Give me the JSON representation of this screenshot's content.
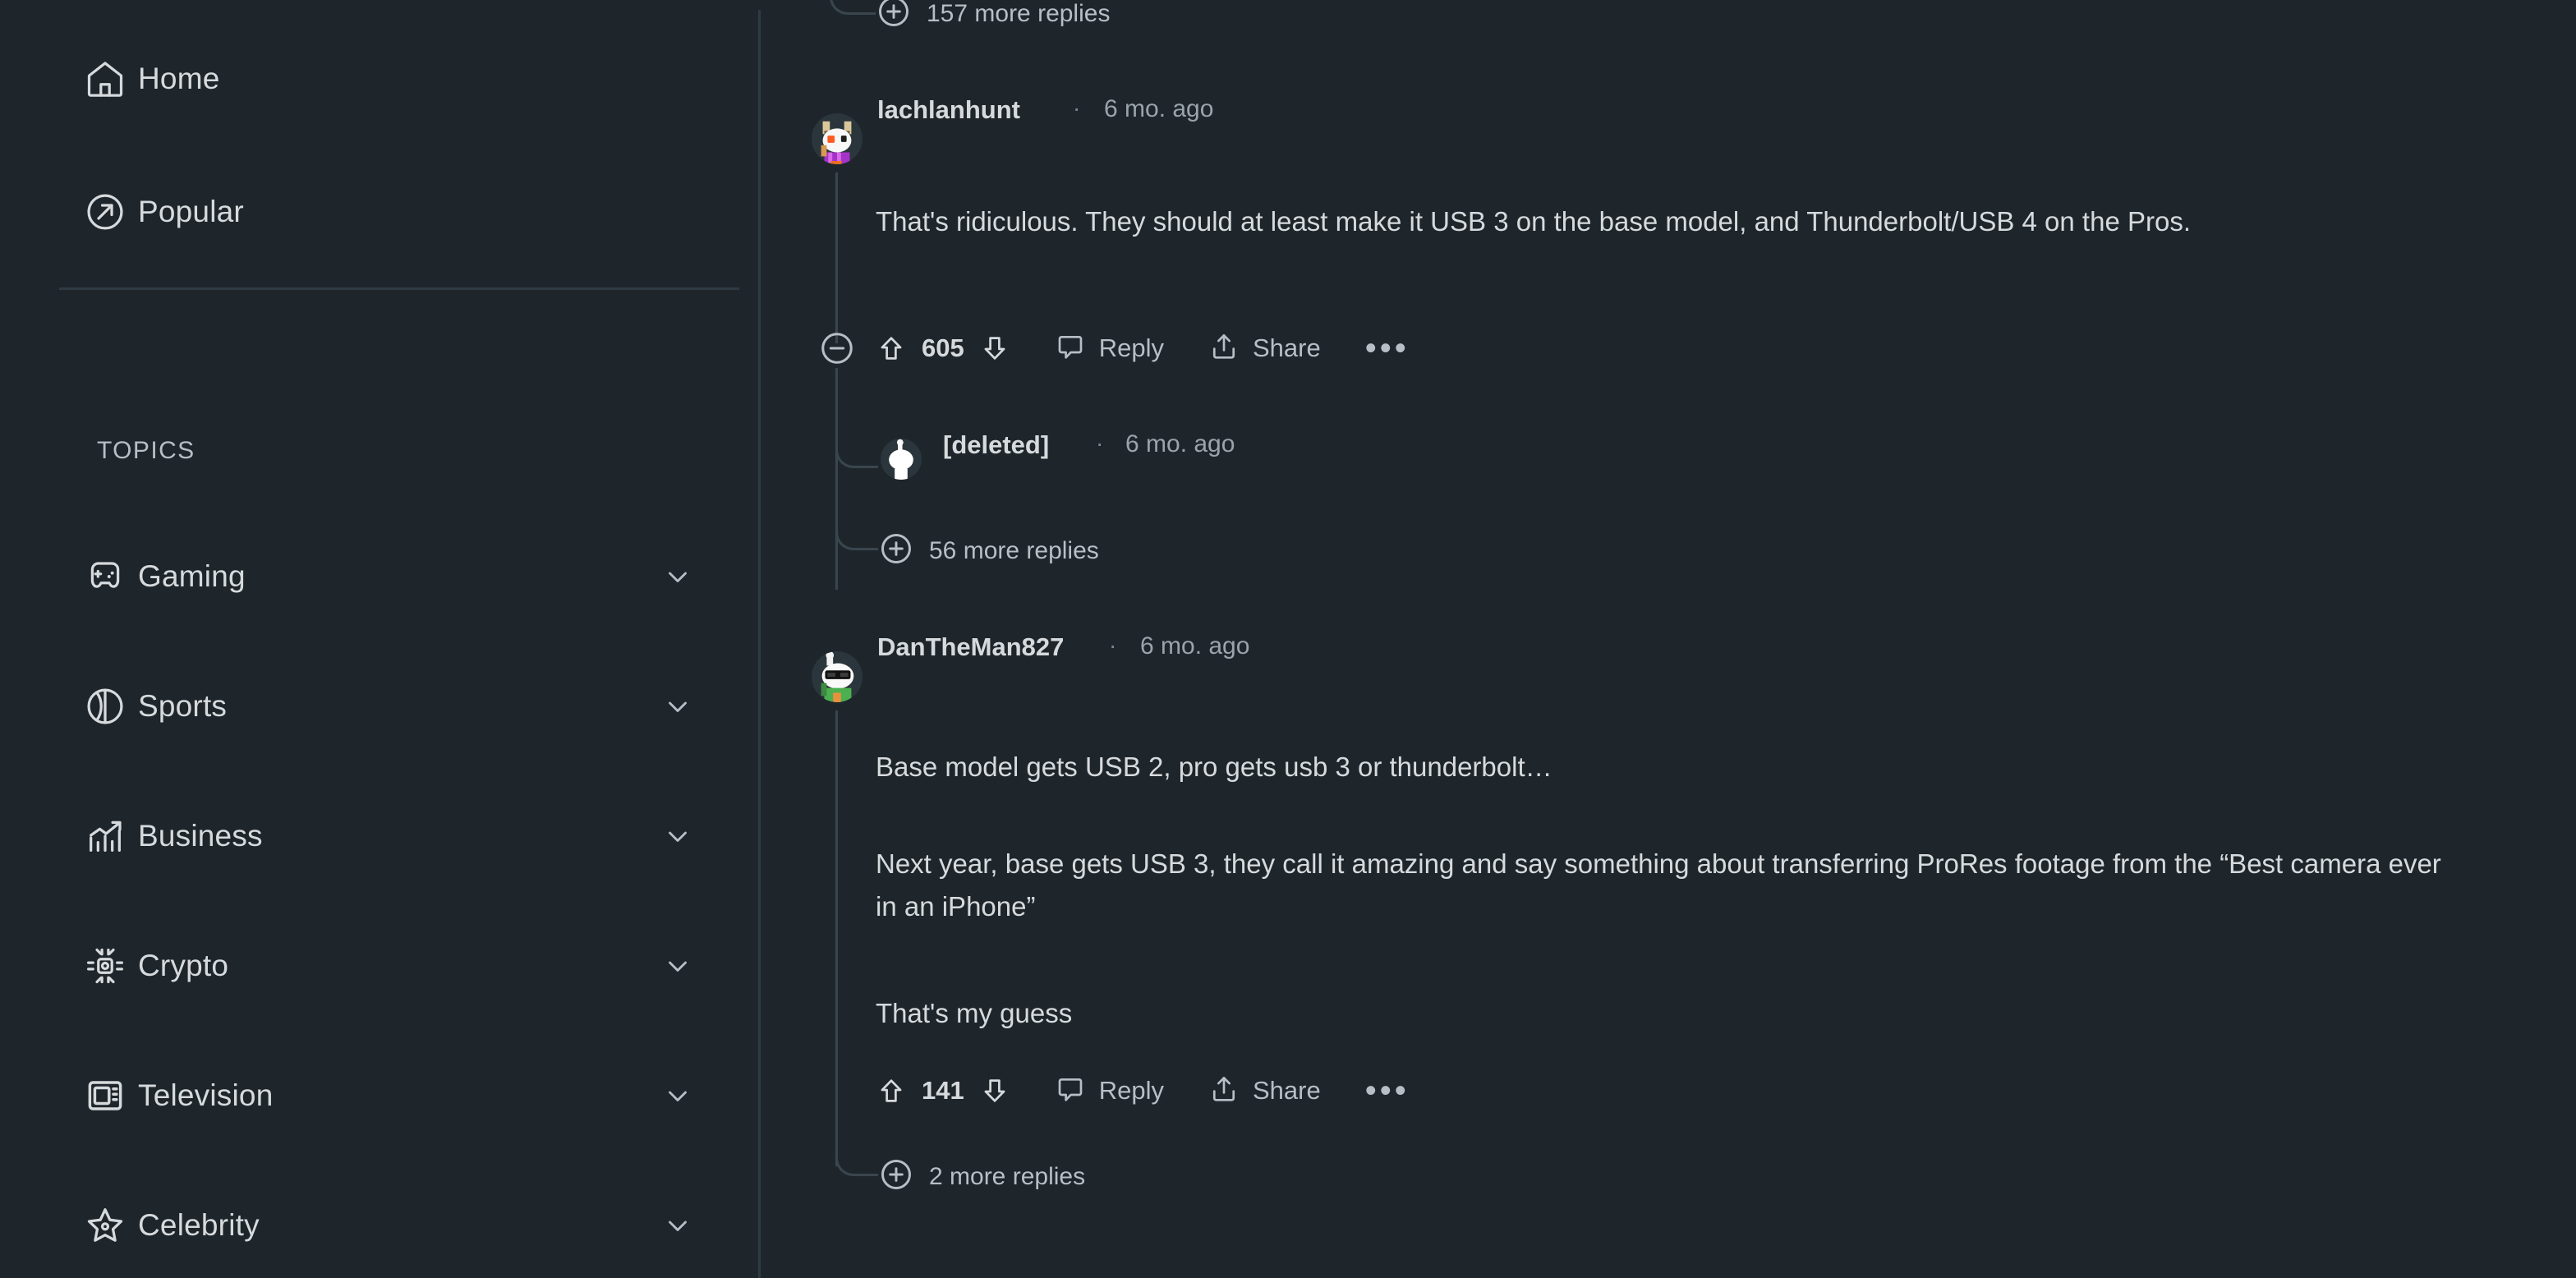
{
  "theme": {
    "background": "#1e262c",
    "divider": "#2f3b43",
    "thread_line": "#3a464e",
    "text_primary": "#d7dadc",
    "text_secondary": "#b6bfc5",
    "text_muted": "#9aa4ab"
  },
  "sidebar": {
    "primary_items": [
      {
        "label": "Home",
        "icon": "home-icon"
      },
      {
        "label": "Popular",
        "icon": "popular-arrow-icon"
      }
    ],
    "topics_header": "TOPICS",
    "topic_items": [
      {
        "label": "Gaming",
        "icon": "gamepad-icon",
        "chevron": "chevron-down-icon"
      },
      {
        "label": "Sports",
        "icon": "sports-ball-icon",
        "chevron": "chevron-down-icon"
      },
      {
        "label": "Business",
        "icon": "chart-bars-icon",
        "chevron": "chevron-down-icon"
      },
      {
        "label": "Crypto",
        "icon": "crypto-icon",
        "chevron": "chevron-down-icon"
      },
      {
        "label": "Television",
        "icon": "television-icon",
        "chevron": "chevron-down-icon"
      },
      {
        "label": "Celebrity",
        "icon": "star-icon",
        "chevron": "chevron-down-icon"
      }
    ]
  },
  "thread": {
    "top_more_replies": {
      "label": "157 more replies",
      "icon": "plus-circle-icon"
    },
    "comments": [
      {
        "author": "lachlanhunt",
        "separator": "·",
        "timestamp": "6 mo. ago",
        "avatar": "snoo-avatar-horns",
        "paragraphs": [
          "That's ridiculous. They should at least make it USB 3 on the base model, and Thunderbolt/USB 4 on the Pros."
        ],
        "actions": {
          "collapse_icon": "minus-circle-icon",
          "upvote_icon": "upvote-arrow-icon",
          "score": "605",
          "downvote_icon": "downvote-arrow-icon",
          "reply_icon": "comment-bubble-icon",
          "reply_label": "Reply",
          "share_icon": "share-upload-icon",
          "share_label": "Share",
          "more_icon": "ellipsis-icon"
        },
        "children": [
          {
            "author": "[deleted]",
            "separator": "·",
            "timestamp": "6 mo. ago",
            "avatar": "snoo-avatar-default"
          }
        ],
        "child_more_replies": {
          "label": "56 more replies",
          "icon": "plus-circle-icon"
        }
      },
      {
        "author": "DanTheMan827",
        "separator": "·",
        "timestamp": "6 mo. ago",
        "avatar": "snoo-avatar-sunglasses",
        "paragraphs": [
          "Base model gets USB 2, pro gets usb 3 or thunderbolt…",
          "Next year, base gets USB 3, they call it amazing and say something about transferring ProRes footage from the “Best camera ever in an iPhone”",
          "That's my guess"
        ],
        "actions": {
          "upvote_icon": "upvote-arrow-icon",
          "score": "141",
          "downvote_icon": "downvote-arrow-icon",
          "reply_icon": "comment-bubble-icon",
          "reply_label": "Reply",
          "share_icon": "share-upload-icon",
          "share_label": "Share",
          "more_icon": "ellipsis-icon"
        },
        "child_more_replies": {
          "label": "2 more replies",
          "icon": "plus-circle-icon"
        }
      }
    ]
  }
}
